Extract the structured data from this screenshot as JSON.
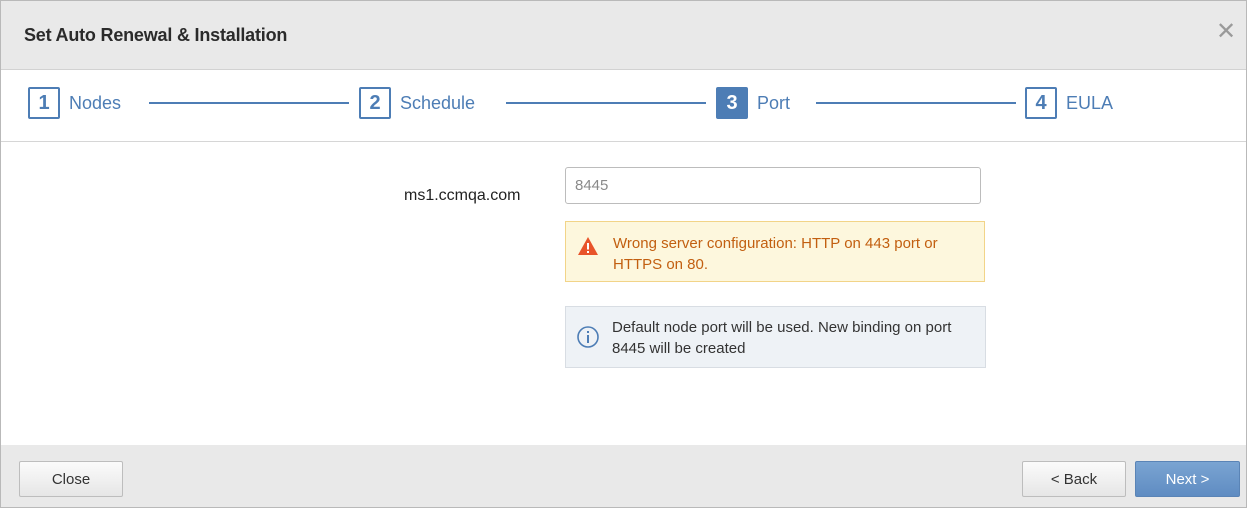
{
  "dialog": {
    "title": "Set Auto Renewal & Installation",
    "close_icon": "close-icon"
  },
  "steps": [
    {
      "number": "1",
      "label": "Nodes",
      "active": false
    },
    {
      "number": "2",
      "label": "Schedule",
      "active": false
    },
    {
      "number": "3",
      "label": "Port",
      "active": true
    },
    {
      "number": "4",
      "label": "EULA",
      "active": false
    }
  ],
  "port_form": {
    "host_label": "ms1.ccmqa.com",
    "port_value": "8445"
  },
  "warning": {
    "icon": "warning-triangle-icon",
    "text": "Wrong server configuration: HTTP on 443 port or HTTPS on 80."
  },
  "info": {
    "icon": "info-circle-icon",
    "text": "Default node port will be used. New binding on port 8445 will be created"
  },
  "footer": {
    "close_label": "Close",
    "back_label": "< Back",
    "next_label": "Next >"
  },
  "colors": {
    "accent": "#4d7db5",
    "warning_text": "#c25f10",
    "warning_icon": "#e8542a"
  }
}
